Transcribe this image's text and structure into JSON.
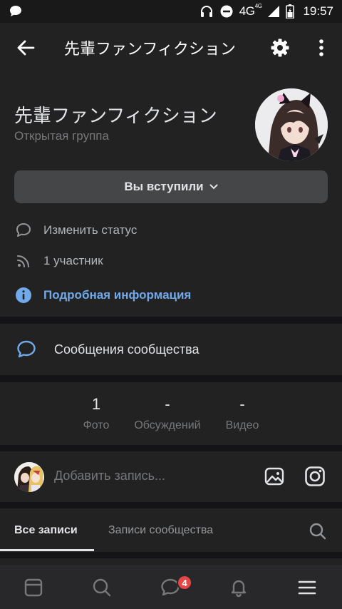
{
  "status_bar": {
    "network": "4G",
    "network_sup": "4G",
    "time": "19:57"
  },
  "header": {
    "title": "先輩ファンフィクション",
    "back_icon": "arrow-left-icon",
    "settings_icon": "gear-icon",
    "more_icon": "more-vertical-icon"
  },
  "group": {
    "name": "先輩ファンフィクション",
    "type": "Открытая группа",
    "joined_label": "Вы вступили",
    "rows": {
      "status_label": "Изменить статус",
      "members_label": "1 участник",
      "info_label": "Подробная информация"
    }
  },
  "community_messages": {
    "label": "Сообщения сообщества"
  },
  "counters": [
    {
      "value": "1",
      "label": "Фото"
    },
    {
      "value": "-",
      "label": "Обсуждений"
    },
    {
      "value": "-",
      "label": "Видео"
    }
  ],
  "add_post": {
    "placeholder": "Добавить запись..."
  },
  "tabs": {
    "all_posts": "Все записи",
    "community_posts": "Записи сообщества"
  },
  "bottom_nav": {
    "messages_badge": "4"
  },
  "colors": {
    "background": "#141416",
    "card": "#222223",
    "accent": "#71aaeb",
    "badge": "#e64646"
  }
}
